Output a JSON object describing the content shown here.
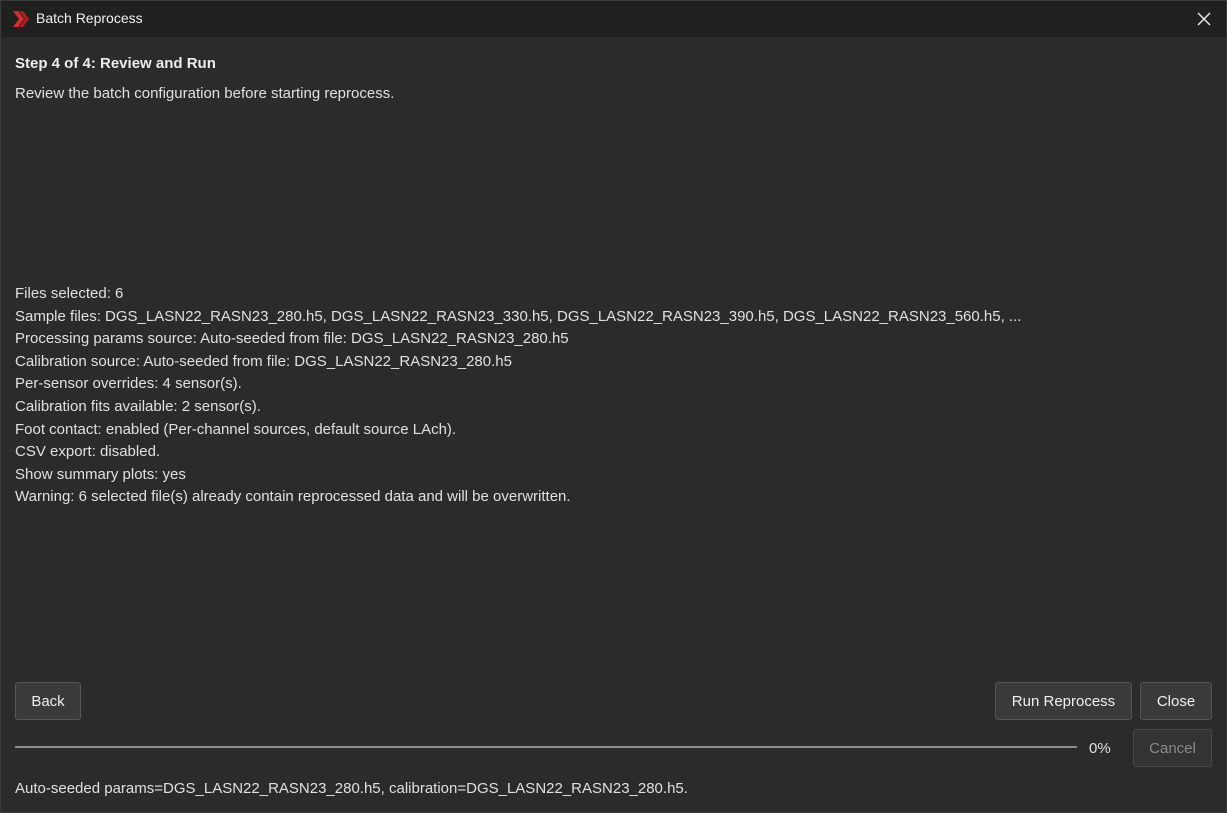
{
  "window": {
    "title": "Batch Reprocess",
    "accent_color": "#d32f2f"
  },
  "step": {
    "title": "Step 4 of 4: Review and Run",
    "description": "Review the batch configuration before starting reprocess."
  },
  "summary": [
    "Files selected: 6",
    "Sample files: DGS_LASN22_RASN23_280.h5, DGS_LASN22_RASN23_330.h5, DGS_LASN22_RASN23_390.h5, DGS_LASN22_RASN23_560.h5, ...",
    "Processing params source: Auto-seeded from file: DGS_LASN22_RASN23_280.h5",
    "Calibration source: Auto-seeded from file: DGS_LASN22_RASN23_280.h5",
    "Per-sensor overrides: 4 sensor(s).",
    "Calibration fits available: 2 sensor(s).",
    "Foot contact: enabled (Per-channel sources, default source LAch).",
    "CSV export: disabled.",
    "Show summary plots: yes",
    "Warning: 6 selected file(s) already contain reprocessed data and will be overwritten."
  ],
  "buttons": {
    "back": "Back",
    "run": "Run Reprocess",
    "close": "Close",
    "cancel": "Cancel"
  },
  "progress": {
    "value": 0,
    "label": "0%"
  },
  "status": "Auto-seeded params=DGS_LASN22_RASN23_280.h5, calibration=DGS_LASN22_RASN23_280.h5."
}
